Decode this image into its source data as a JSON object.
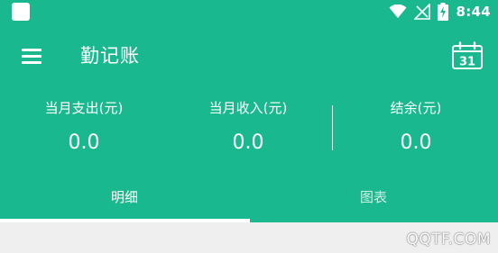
{
  "status_bar": {
    "time": "8:44",
    "icons": [
      "notification-square-icon",
      "wifi-icon",
      "no-signal-icon",
      "battery-charging-icon"
    ]
  },
  "toolbar": {
    "title": "勤记账",
    "menu_icon": "menu-icon",
    "calendar_icon": "calendar-icon",
    "calendar_day": "31"
  },
  "summary": {
    "expense_label": "当月支出(元)",
    "expense_value": "0.0",
    "income_label": "当月收入(元)",
    "income_value": "0.0",
    "balance_label": "结余(元)",
    "balance_value": "0.0"
  },
  "tabs": [
    {
      "label": "明细",
      "selected": true
    },
    {
      "label": "图表",
      "selected": false
    }
  ],
  "watermark": "QQTF.COM",
  "colors": {
    "primary": "#1ab88e",
    "on_primary": "#ffffff",
    "background": "#efefef"
  }
}
